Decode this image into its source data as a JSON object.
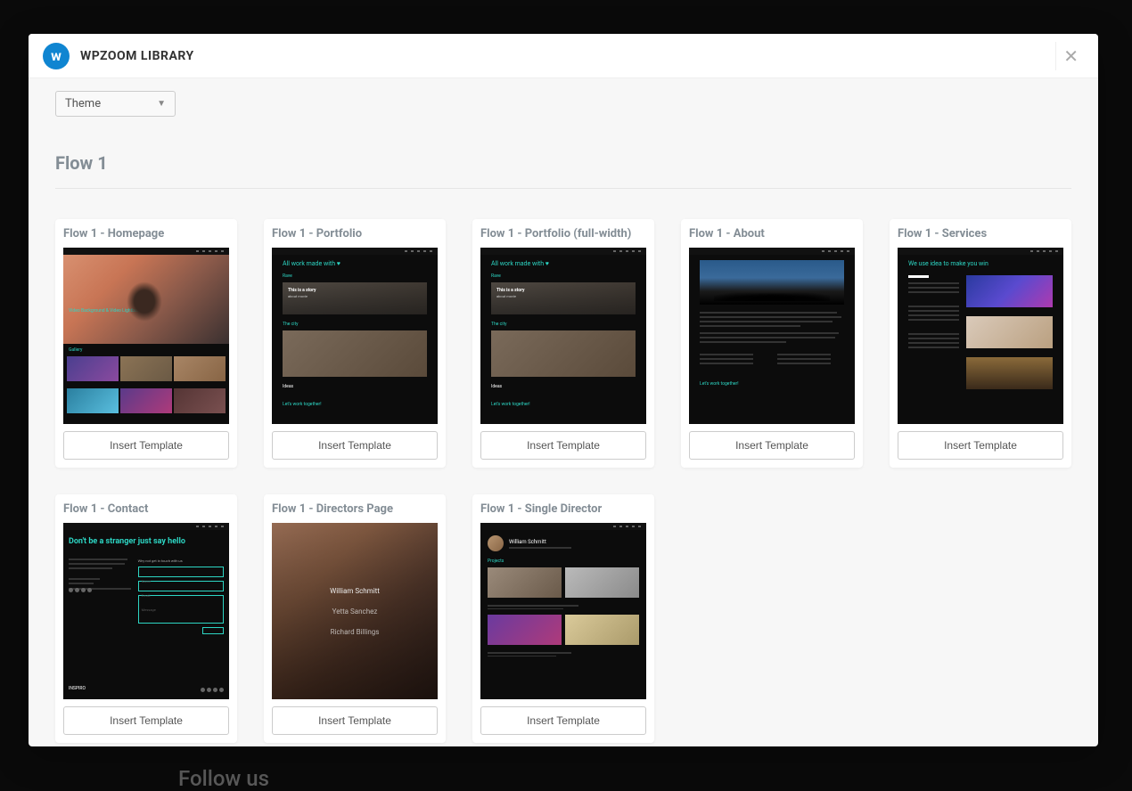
{
  "backdrop": {
    "follow_us": "Follow us"
  },
  "modal": {
    "logo_letter": "w",
    "title": "WPZOOM LIBRARY",
    "theme_select": "Theme",
    "section_title": "Flow 1",
    "insert_label": "Insert Template",
    "templates": [
      {
        "title": "Flow 1 - Homepage"
      },
      {
        "title": "Flow 1 - Portfolio"
      },
      {
        "title": "Flow 1 - Portfolio (full-width)"
      },
      {
        "title": "Flow 1 - About"
      },
      {
        "title": "Flow 1 - Services"
      },
      {
        "title": "Flow 1 - Contact"
      },
      {
        "title": "Flow 1 - Directors Page"
      },
      {
        "title": "Flow 1 - Single Director"
      }
    ],
    "preview_text": {
      "homepage_hero": "Video\nBackground &\nVideo Lightbox",
      "portfolio_heading": "All work\nmade with ♥",
      "portfolio_tag1": "Rave",
      "portfolio_story1": "This is a story",
      "portfolio_story2": "about movie",
      "portfolio_tag2": "The city",
      "portfolio_ideas": "Ideas",
      "portfolio_cta": "Let's work together!",
      "about_cta": "Let's work together!",
      "services_heading": "We use idea to\nmake you win",
      "contact_heading": "Don't be a\nstranger\njust say hello",
      "contact_brand": "INSPIRO",
      "directors": [
        "William Schmitt",
        "Yetta Sanchez",
        "Richard Billings"
      ],
      "single_name": "William Schmitt",
      "single_section": "Projects"
    }
  }
}
